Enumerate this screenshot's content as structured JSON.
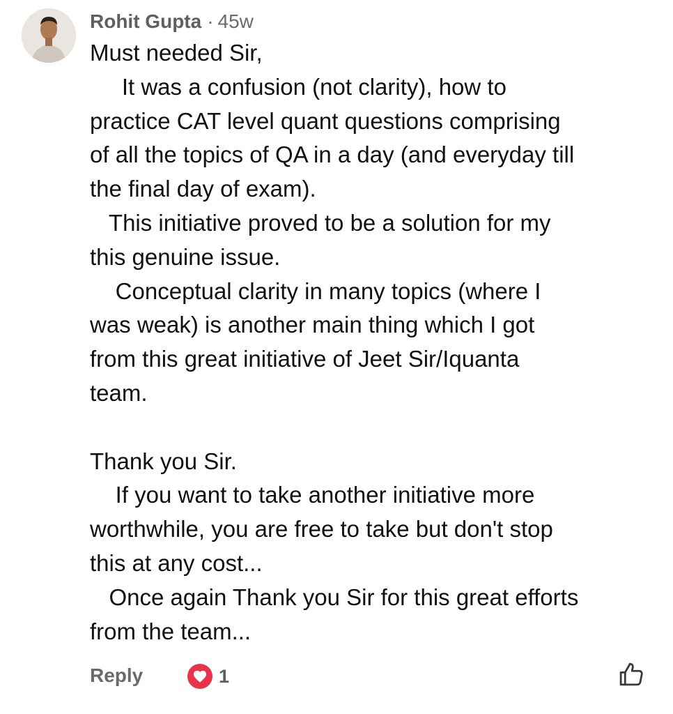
{
  "comment": {
    "author": "Rohit Gupta",
    "separator": "·",
    "timestamp": "45w",
    "lines": [
      "Must needed Sir,",
      "     It was a confusion (not clarity), how to",
      "practice CAT level quant questions comprising",
      "of all the topics of QA in a day (and everyday till",
      "the final day of exam).",
      "   This initiative proved to be a solution for my",
      "this genuine issue.",
      "    Conceptual clarity in many topics (where I",
      "was weak) is another main thing which I got",
      "from this great initiative of Jeet Sir/Iquanta",
      "team.",
      "",
      "Thank you Sir.",
      "    If you want to take another initiative more",
      "worthwhile, you are free to take but don't stop",
      "this at any cost...",
      "   Once again Thank you Sir for this great efforts",
      "from the team..."
    ]
  },
  "footer": {
    "reply_label": "Reply",
    "reaction_icon": "heart-icon",
    "reaction_count": "1",
    "like_icon": "thumbs-up-icon"
  },
  "colors": {
    "reaction_red": "#e8334a",
    "meta_gray": "#6a6a6a",
    "text": "#111111"
  }
}
